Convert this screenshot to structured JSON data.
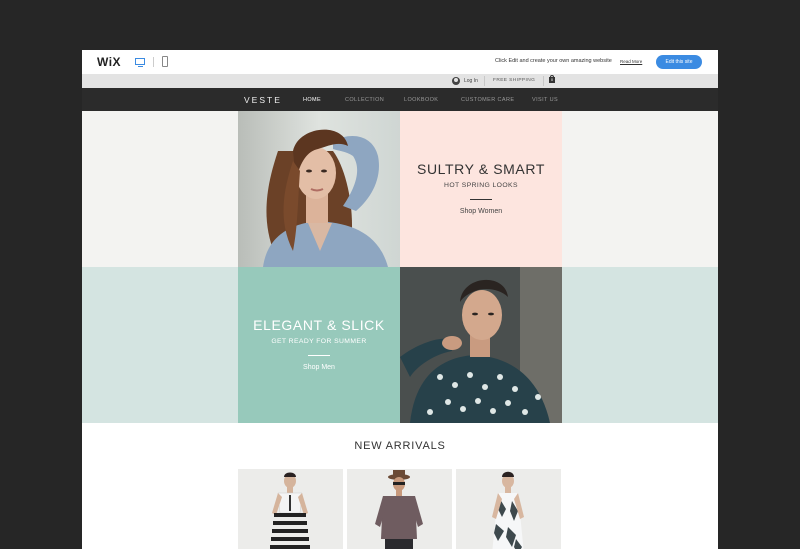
{
  "wix_bar": {
    "logo": "WiX",
    "promo_text": "Click Edit and create your own amazing website",
    "read_more": "Read More",
    "edit_button": "Edit this site"
  },
  "util_bar": {
    "login": "Log In",
    "free_shipping": "FREE SHIPPING",
    "cart_count": "0"
  },
  "nav": {
    "brand": "VESTE",
    "items": [
      {
        "label": "HOME",
        "active": true
      },
      {
        "label": "COLLECTION"
      },
      {
        "label": "LOOKBOOK"
      },
      {
        "label": "CUSTOMER CARE"
      },
      {
        "label": "VISIT US"
      }
    ]
  },
  "hero": {
    "women": {
      "title": "SULTRY & SMART",
      "subtitle": "HOT SPRING LOOKS",
      "link": "Shop Women",
      "color": "#fde5df"
    },
    "men": {
      "title": "ELEGANT & SLICK",
      "subtitle": "GET READY FOR SUMMER",
      "link": "Shop Men",
      "color": "#97c9bb"
    }
  },
  "arrivals": {
    "title": "NEW ARRIVALS"
  },
  "colors": {
    "background": "#262626",
    "accent": "#3b8be2",
    "nav": "#2b2b2b",
    "row2": "#d4e4e1"
  }
}
